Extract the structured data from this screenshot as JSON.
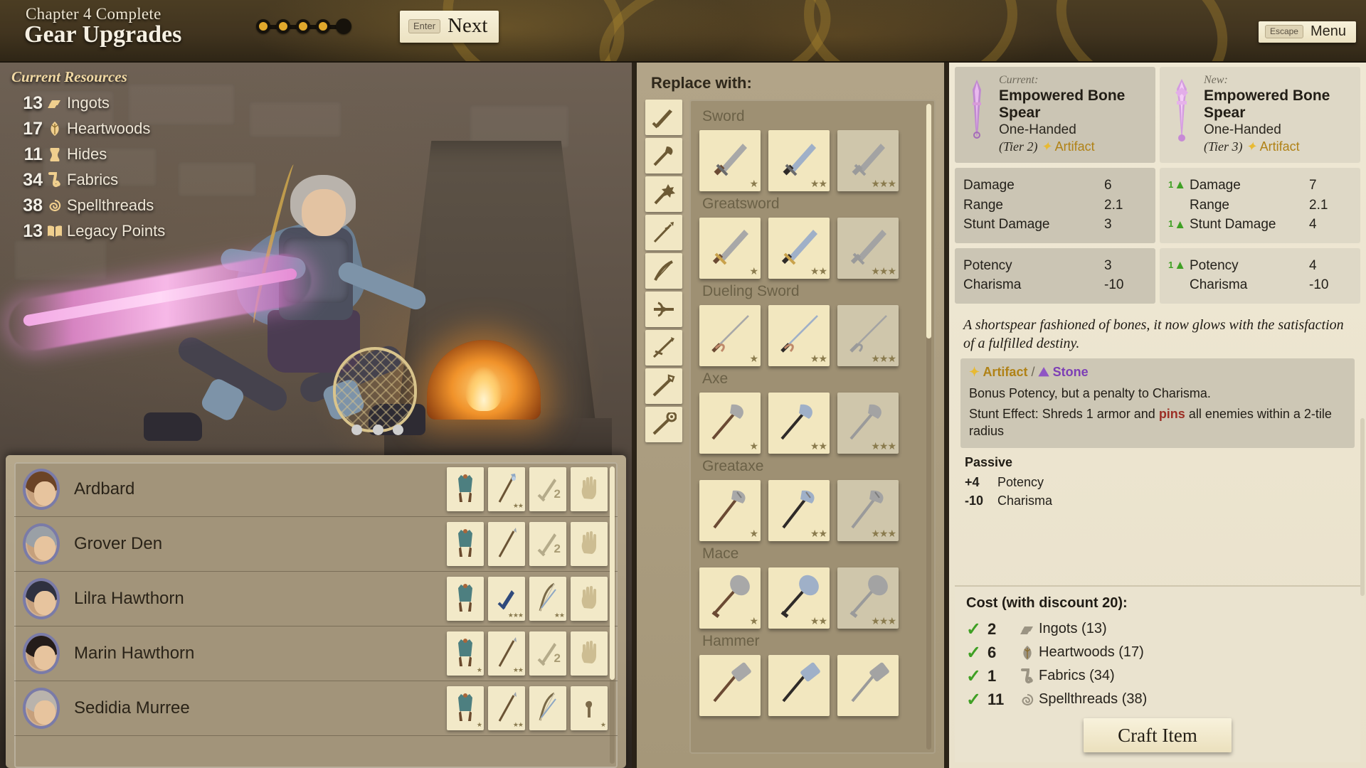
{
  "header": {
    "chapter_label": "Chapter 4 Complete",
    "page_title": "Gear Upgrades",
    "progress": {
      "total": 5,
      "filled": 4
    },
    "next_button": {
      "key": "Enter",
      "label": "Next"
    },
    "menu_button": {
      "key": "Escape",
      "label": "Menu"
    }
  },
  "resources": {
    "title": "Current Resources",
    "items": [
      {
        "amount": "13",
        "name": "Ingots",
        "icon": "ingot-icon"
      },
      {
        "amount": "17",
        "name": "Heartwoods",
        "icon": "leaf-icon"
      },
      {
        "amount": "11",
        "name": "Hides",
        "icon": "hide-icon"
      },
      {
        "amount": "34",
        "name": "Fabrics",
        "icon": "fabric-icon"
      },
      {
        "amount": "38",
        "name": "Spellthreads",
        "icon": "spiral-icon"
      },
      {
        "amount": "13",
        "name": "Legacy Points",
        "icon": "book-icon"
      }
    ]
  },
  "party": {
    "members": [
      {
        "name": "Ardbard",
        "hair": "#6b4326",
        "slots": [
          {
            "icon": "armor-icon",
            "stars": ""
          },
          {
            "icon": "staff-icon",
            "stars": "★★"
          },
          {
            "icon": "sword-icon",
            "qty": "2"
          },
          {
            "icon": "hand-icon",
            "stars": ""
          }
        ]
      },
      {
        "name": "Grover Den",
        "hair": "#9aa0a6",
        "slots": [
          {
            "icon": "armor-icon",
            "stars": ""
          },
          {
            "icon": "spear-icon",
            "stars": ""
          },
          {
            "icon": "sword-icon",
            "qty": "2"
          },
          {
            "icon": "hand-icon",
            "stars": ""
          }
        ]
      },
      {
        "name": "Lilra Hawthorn",
        "hair": "#2f3140",
        "slots": [
          {
            "icon": "armor-icon",
            "stars": ""
          },
          {
            "icon": "dagger-icon",
            "stars": "★★★"
          },
          {
            "icon": "bow-icon",
            "stars": "★★"
          },
          {
            "icon": "hand-icon",
            "stars": ""
          }
        ]
      },
      {
        "name": "Marin Hawthorn",
        "hair": "#241c1a",
        "slots": [
          {
            "icon": "armor-icon",
            "stars": "★"
          },
          {
            "icon": "spear-icon",
            "stars": "★★"
          },
          {
            "icon": "sword-icon",
            "qty": "2"
          },
          {
            "icon": "hand-icon",
            "stars": ""
          }
        ]
      },
      {
        "name": "Sedidia Murree",
        "hair": "#b9b3ac",
        "slots": [
          {
            "icon": "armor-icon",
            "stars": "★"
          },
          {
            "icon": "spear-icon",
            "stars": "★★"
          },
          {
            "icon": "bow-icon",
            "stars": ""
          },
          {
            "icon": "misc-icon",
            "stars": "★"
          }
        ]
      }
    ]
  },
  "replace": {
    "title": "Replace with:",
    "category_filters": [
      "sword-filter-icon",
      "axe-filter-icon",
      "mace-filter-icon",
      "spear-filter-icon",
      "bow-filter-icon",
      "crossbow-filter-icon",
      "javelin-filter-icon",
      "staff-filter-icon",
      "wand-filter-icon"
    ],
    "groups": [
      {
        "label": "Sword",
        "items": [
          {
            "stars": "★"
          },
          {
            "stars": "★★"
          },
          {
            "stars": "★★★",
            "tier3": true
          }
        ]
      },
      {
        "label": "Greatsword",
        "items": [
          {
            "stars": "★"
          },
          {
            "stars": "★★"
          },
          {
            "stars": "★★★",
            "tier3": true
          }
        ]
      },
      {
        "label": "Dueling Sword",
        "items": [
          {
            "stars": "★"
          },
          {
            "stars": "★★"
          },
          {
            "stars": "★★★",
            "tier3": true
          }
        ]
      },
      {
        "label": "Axe",
        "items": [
          {
            "stars": "★"
          },
          {
            "stars": "★★"
          },
          {
            "stars": "★★★",
            "tier3": true
          }
        ]
      },
      {
        "label": "Greataxe",
        "items": [
          {
            "stars": "★"
          },
          {
            "stars": "★★"
          },
          {
            "stars": "★★★",
            "tier3": true
          }
        ]
      },
      {
        "label": "Mace",
        "items": [
          {
            "stars": "★"
          },
          {
            "stars": "★★"
          },
          {
            "stars": "★★★",
            "tier3": true
          }
        ]
      },
      {
        "label": "Hammer",
        "items": [
          {
            "stars": ""
          },
          {
            "stars": ""
          },
          {
            "stars": ""
          }
        ]
      }
    ]
  },
  "detail": {
    "current": {
      "kind_label": "Current:",
      "name": "Empowered Bone Spear",
      "hand": "One-Handed",
      "tier": "(Tier 2)",
      "rarity": "Artifact",
      "combat_stats": [
        {
          "name": "Damage",
          "value": "6",
          "delta": ""
        },
        {
          "name": "Range",
          "value": "2.1",
          "delta": ""
        },
        {
          "name": "Stunt Damage",
          "value": "3",
          "delta": ""
        }
      ],
      "attr_stats": [
        {
          "name": "Potency",
          "value": "3",
          "delta": ""
        },
        {
          "name": "Charisma",
          "value": "-10",
          "delta": ""
        }
      ]
    },
    "new": {
      "kind_label": "New:",
      "name": "Empowered Bone Spear",
      "hand": "One-Handed",
      "tier": "(Tier 3)",
      "rarity": "Artifact",
      "combat_stats": [
        {
          "name": "Damage",
          "value": "7",
          "delta": "1"
        },
        {
          "name": "Range",
          "value": "2.1",
          "delta": ""
        },
        {
          "name": "Stunt Damage",
          "value": "4",
          "delta": "1"
        }
      ],
      "attr_stats": [
        {
          "name": "Potency",
          "value": "4",
          "delta": "1"
        },
        {
          "name": "Charisma",
          "value": "-10",
          "delta": ""
        }
      ]
    },
    "flavor_text": "A shortspear fashioned of bones, it now glows with the satisfaction of a fulfilled destiny.",
    "traits": {
      "tag_artifact": "Artifact",
      "tag_separator": "/",
      "tag_material": "Stone",
      "line1": "Bonus Potency, but a penalty to Charisma.",
      "stunt_prefix": "Stunt Effect: Shreds 1 armor and ",
      "stunt_keyword": "pins",
      "stunt_suffix": " all enemies within a 2-tile radius"
    },
    "passive": {
      "title": "Passive",
      "rows": [
        {
          "amount": "+4",
          "name": "Potency"
        },
        {
          "amount": "-10",
          "name": "Charisma"
        }
      ]
    },
    "cost": {
      "title": "Cost (with discount 20):",
      "rows": [
        {
          "check": "✓",
          "amount": "2",
          "icon": "ingot-icon",
          "name": "Ingots (13)"
        },
        {
          "check": "✓",
          "amount": "6",
          "icon": "leaf-icon",
          "name": "Heartwoods (17)"
        },
        {
          "check": "✓",
          "amount": "1",
          "icon": "fabric-icon",
          "name": "Fabrics (34)"
        },
        {
          "check": "✓",
          "amount": "11",
          "icon": "spiral-icon",
          "name": "Spellthreads (38)"
        }
      ],
      "craft_button": "Craft Item"
    }
  },
  "colors": {
    "artifact": "#b08216",
    "stone": "#7d3fb5",
    "positive": "#3fa024",
    "keyword": "#9c2f25",
    "accent_amber": "#e0a82c"
  }
}
